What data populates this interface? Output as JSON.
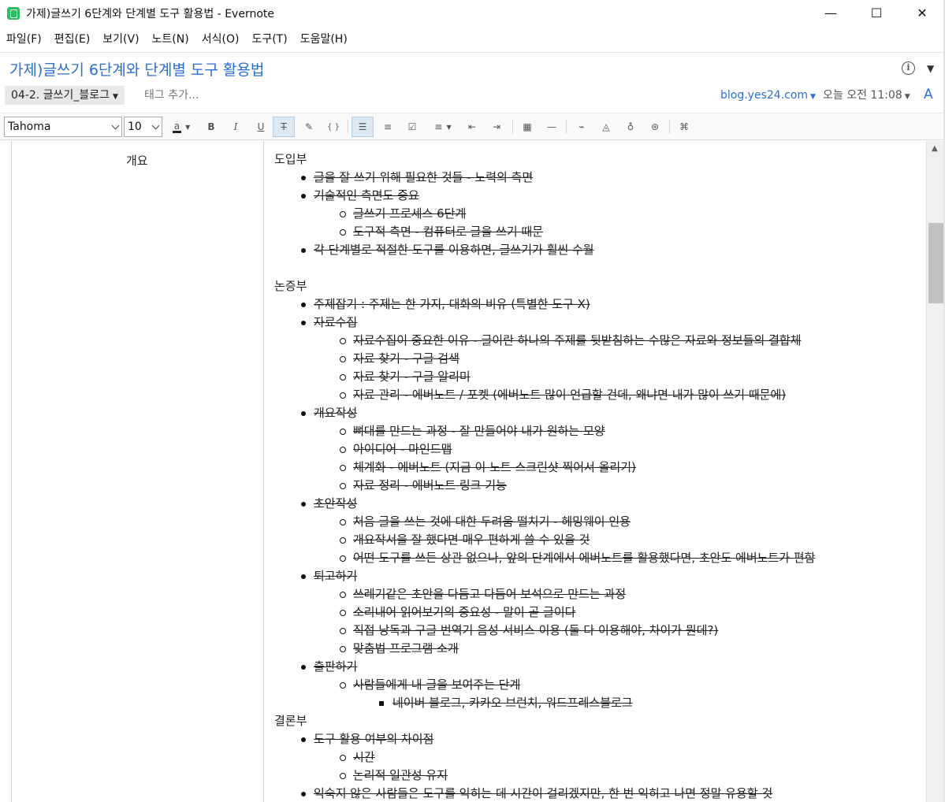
{
  "window": {
    "title": "가제)글쓰기 6단계와 단계별 도구 활용법 - Evernote",
    "minimize": "—",
    "maximize": "☐",
    "close": "✕"
  },
  "menu": [
    "파일(F)",
    "편집(E)",
    "보기(V)",
    "노트(N)",
    "서식(O)",
    "도구(T)",
    "도움말(H)"
  ],
  "note": {
    "title": "가제)글쓰기 6단계와 단계별 도구 활용법",
    "notebook": "04-2. 글쓰기_블로그",
    "tag_placeholder": "태그 추가...",
    "source_url": "blog.yes24.com",
    "timestamp": "오늘 오전 11:08",
    "font_size_icon": "A"
  },
  "toolbar": {
    "font_family": "Tahoma",
    "font_size": "10",
    "buttons": [
      "font-color",
      "bold",
      "italic",
      "underline",
      "strikethrough",
      "highlight",
      "code-block",
      "bulleted-list",
      "numbered-list",
      "checkbox",
      "align",
      "outdent",
      "indent",
      "table",
      "horizontal-rule",
      "attach",
      "encrypt",
      "record-audio",
      "presentation",
      "command"
    ],
    "active": [
      "strikethrough",
      "bulleted-list"
    ]
  },
  "content": {
    "label_cell": "개요",
    "sections": [
      {
        "heading": "도입부",
        "items": [
          {
            "text": "글을 잘 쓰기 위해 필요한 것들 - 노력의 측면"
          },
          {
            "text": "기술적인 측면도 중요",
            "children": [
              {
                "text": "글쓰기 프로세스 6단계"
              },
              {
                "text": "도구적 측면 - 컴퓨터로 글을 쓰기 때문"
              }
            ]
          },
          {
            "text": "각 단계별로 적절한 도구를 이용하면, 글쓰기가 훨씬 수월"
          }
        ]
      },
      {
        "heading": "논증부",
        "items": [
          {
            "text": "주제잡기 : 주제는 한 가지, 대화의 비유 (특별한 도구 X)"
          },
          {
            "text": "자료수집",
            "children": [
              {
                "text": "자료수집이 중요한 이유 - 글이란 하나의 주제를 뒷받침하는 수많은 자료와 정보들의 결합체"
              },
              {
                "text": "자료 찾기 - 구글 검색"
              },
              {
                "text": "자료 찾기 - 구글 알리미"
              },
              {
                "text": "자료 관리 - 에버노트 / 포켓 (에버노트 많이 언급할 건데, 왜냐면 내가 많이 쓰기 때문에)"
              }
            ]
          },
          {
            "text": "개요작성",
            "children": [
              {
                "text": "뼈대를 만드는 과정 - 잘 만들어야 내가 원하는 모양"
              },
              {
                "text": "아이디어 - 마인드맵"
              },
              {
                "text": "체계화 - 에버노트 (지금 이 노트 스크린샷 찍어서 올리기)"
              },
              {
                "text": "자료 정리 - 에버노트 링크 기능"
              }
            ]
          },
          {
            "text": "초안작성",
            "children": [
              {
                "text": "처음 글을 쓰는 것에 대한 두려움 떨치기 - 헤밍웨이 인용"
              },
              {
                "text": "개요작서을 잘 했다면 매우 편하게 쓸 수 있을 것"
              },
              {
                "text": "어떤 도구를 쓰든 상관 없으나, 앞의 단계에서 에버노트를 활용했다면, 초안도 에버노트가 편함"
              }
            ]
          },
          {
            "text": "퇴고하기",
            "children": [
              {
                "text": "쓰레기같은 초안을 다듬고 다듬어 보석으로 만드는 과정"
              },
              {
                "text": "소리내어 읽어보기의 중요성 - 말이 곧 글이다"
              },
              {
                "text": "직접 낭독과 구글 번역기 음성 서비스 이용 (둘 다 이용해야, 차이가 뭔데?)"
              },
              {
                "text": "맞춤법 프로그램 소개"
              }
            ]
          },
          {
            "text": "출판하기",
            "children": [
              {
                "text": "사람들에게 내 글을 보여주는 단계",
                "children": [
                  {
                    "text": "네이버 블로그, 카카오 브런치, 워드프레스블로그"
                  }
                ]
              }
            ]
          }
        ]
      },
      {
        "heading": "결론부",
        "items": [
          {
            "text": "도구 활용 여부의 차이점",
            "children": [
              {
                "text": "시간"
              },
              {
                "text": "논리적 일관성 유지"
              }
            ]
          },
          {
            "text": "익숙지 않은 사람들은 도구를 익히는 데 시간이 걸리겠지만, 한 번 익히고 나면 정말 유용할 것"
          }
        ]
      }
    ]
  }
}
